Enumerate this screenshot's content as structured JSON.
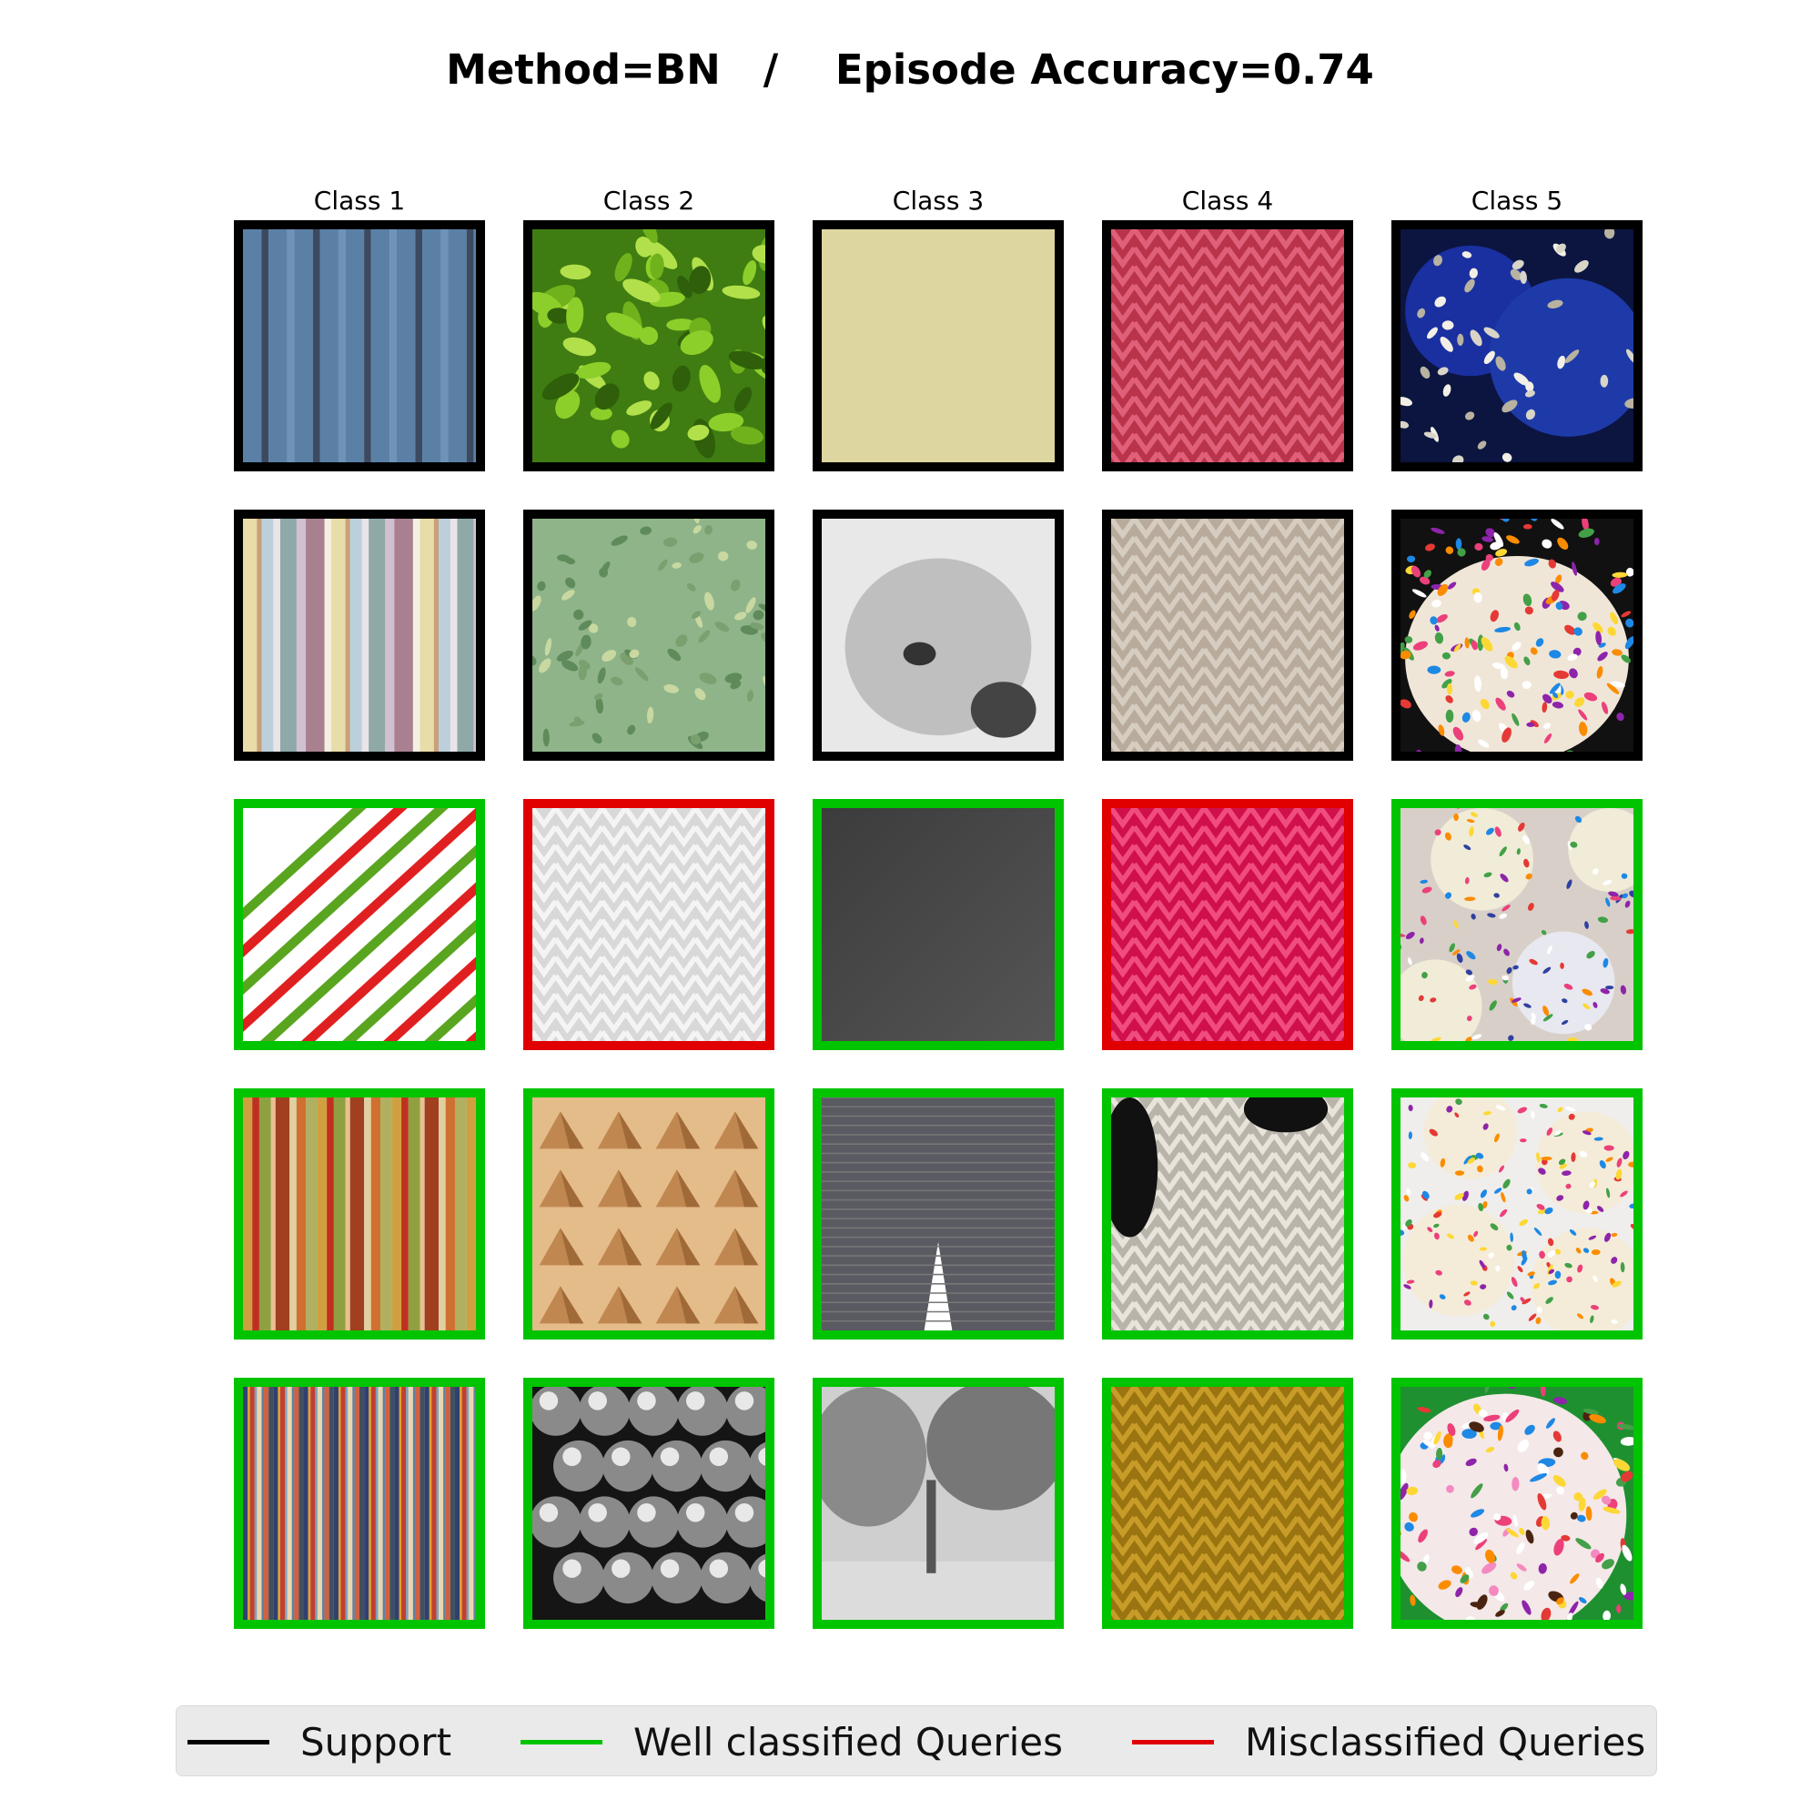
{
  "title": "Method=BN   /    Episode Accuracy=0.74",
  "columns": [
    "Class 1",
    "Class 2",
    "Class 3",
    "Class 4",
    "Class 5"
  ],
  "colors": {
    "support": "#000000",
    "well_classified": "#00c400",
    "misclassified": "#e00000"
  },
  "grid": [
    [
      {
        "status": "support",
        "image": "blue-vertical-stripes"
      },
      {
        "status": "support",
        "image": "green-bumpy-moss"
      },
      {
        "status": "support",
        "image": "beige-plain-fabric"
      },
      {
        "status": "support",
        "image": "red-knit"
      },
      {
        "status": "support",
        "image": "blue-silver-sprinkled-balls"
      }
    ],
    [
      {
        "status": "support",
        "image": "pastel-vertical-stripes"
      },
      {
        "status": "support",
        "image": "green-scaly-texture"
      },
      {
        "status": "support",
        "image": "grayscale-sketch-koala"
      },
      {
        "status": "support",
        "image": "beige-knit"
      },
      {
        "status": "support",
        "image": "rainbow-sprinkles"
      }
    ],
    [
      {
        "status": "well_classified",
        "image": "red-green-diagonal-stripes"
      },
      {
        "status": "misclassified",
        "image": "white-woven-fabric"
      },
      {
        "status": "well_classified",
        "image": "dark-gray-fabric"
      },
      {
        "status": "misclassified",
        "image": "pink-knit"
      },
      {
        "status": "well_classified",
        "image": "sprinkled-cake-pops"
      }
    ],
    [
      {
        "status": "well_classified",
        "image": "multicolor-vertical-stripes"
      },
      {
        "status": "well_classified",
        "image": "wooden-pyramid-pattern"
      },
      {
        "status": "well_classified",
        "image": "gray-plaid-pants"
      },
      {
        "status": "well_classified",
        "image": "white-knit"
      },
      {
        "status": "well_classified",
        "image": "sprinkled-cookies"
      }
    ],
    [
      {
        "status": "well_classified",
        "image": "thin-multicolor-stripes"
      },
      {
        "status": "well_classified",
        "image": "metal-balls"
      },
      {
        "status": "well_classified",
        "image": "grayscale-tree-landscape"
      },
      {
        "status": "well_classified",
        "image": "mustard-cable-knit"
      },
      {
        "status": "well_classified",
        "image": "sprinkled-donut"
      }
    ]
  ],
  "legend": [
    {
      "key": "support",
      "label": "Support"
    },
    {
      "key": "well_classified",
      "label": "Well classified Queries"
    },
    {
      "key": "misclassified",
      "label": "Misclassified Queries"
    }
  ]
}
